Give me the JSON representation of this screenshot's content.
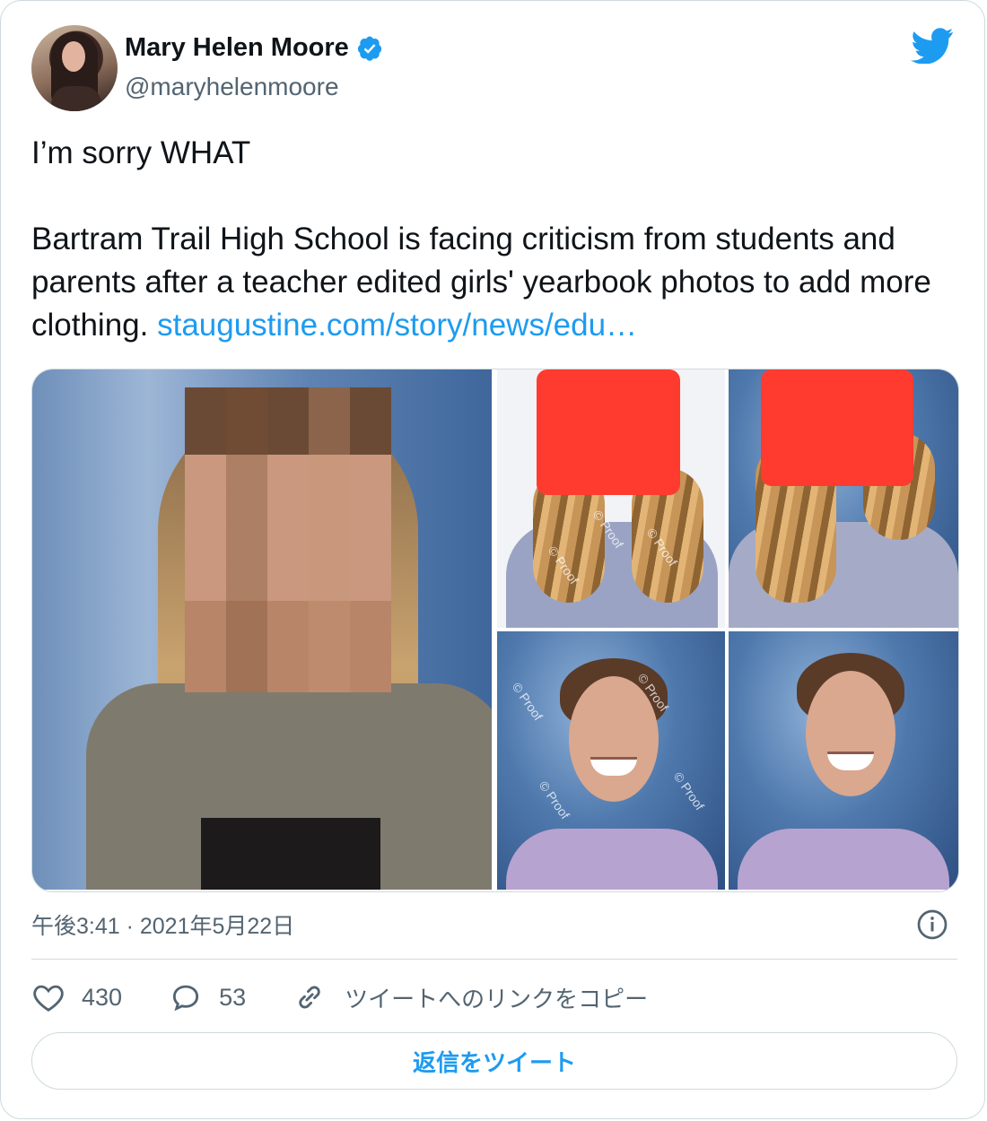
{
  "author": {
    "name": "Mary Helen Moore",
    "handle": "@maryhelenmoore",
    "verified": true
  },
  "tweet": {
    "line1": "I’m sorry WHAT",
    "body": "Bartram Trail High School is facing criticism from students and parents after a teacher edited girls' yearbook photos to add more clothing. ",
    "link": "staugustine.com/story/news/edu…"
  },
  "media": {
    "watermark": "© Proof"
  },
  "meta": {
    "timestamp": "午後3:41 · 2021年5月22日"
  },
  "actions": {
    "likes": "430",
    "replies": "53",
    "copy_link": "ツイートへのリンクをコピー"
  },
  "reply_button": "返信をツイート",
  "colors": {
    "accent": "#1d9bf0",
    "text": "#0f1419",
    "secondary": "#536471",
    "border": "#cfd9de"
  },
  "icons": [
    "verified-badge-icon",
    "twitter-bird-icon",
    "info-icon",
    "heart-icon",
    "reply-bubble-icon",
    "link-icon"
  ]
}
